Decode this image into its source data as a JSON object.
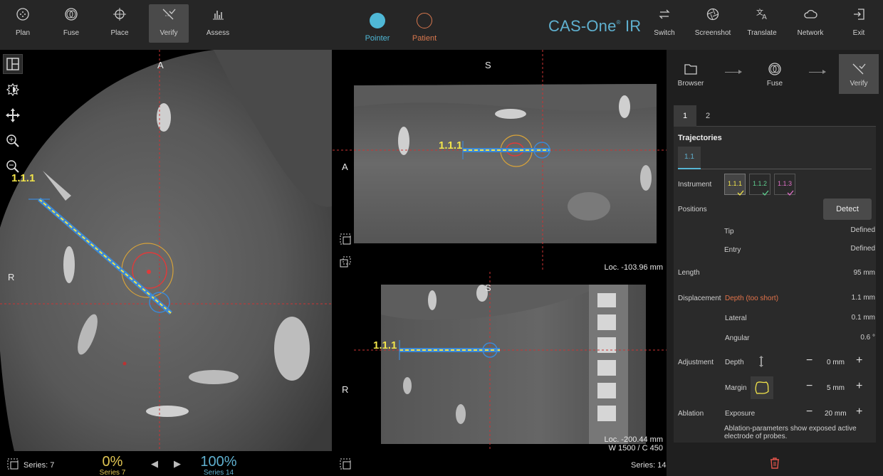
{
  "toolbar": {
    "plan": "Plan",
    "fuse": "Fuse",
    "place": "Place",
    "verify": "Verify",
    "assess": "Assess",
    "pointer": "Pointer",
    "patient": "Patient",
    "brand": "CAS-One",
    "brand_mark": "®",
    "brand_suffix": " IR",
    "switch": "Switch",
    "screenshot": "Screenshot",
    "translate": "Translate",
    "network": "Network",
    "exit": "Exit"
  },
  "colors": {
    "pointer": "#4fb8d6",
    "patient": "#d9784e",
    "brand": "#5fb0cf",
    "trajectory": "#f2e44a",
    "accent": "#58b7d6",
    "warning": "#e2734a"
  },
  "views": {
    "axial": {
      "top": "A",
      "left": "R",
      "traj": "1.1.1"
    },
    "coronal": {
      "top": "S",
      "left": "A",
      "traj": "1.1.1",
      "loc": "Loc. -103.96 mm"
    },
    "sagittal": {
      "top": "S",
      "left": "R",
      "traj": "1.1.1",
      "loc": "Loc. -200.44 mm",
      "wl": "W 1500 / C 450"
    }
  },
  "bottom": {
    "series_left": "Series: 7",
    "pct_left": "0%",
    "pct_left_sub": "Series 7",
    "pct_right": "100%",
    "pct_right_sub": "Series 14",
    "series_right": "Series: 14"
  },
  "panel": {
    "workflow": [
      "Browser",
      "Fuse",
      "Verify"
    ],
    "tabs": [
      "1",
      "2"
    ],
    "section": "Trajectories",
    "subtab": "1.1",
    "instrument_label": "Instrument",
    "instruments": [
      "1.1.1",
      "1.1.2",
      "1.1.3"
    ],
    "positions_label": "Positions",
    "detect": "Detect",
    "tip_label": "Tip",
    "tip_val": "Defined",
    "entry_label": "Entry",
    "entry_val": "Defined",
    "length_label": "Length",
    "length_val": "95 mm",
    "displacement_label": "Displacement",
    "depth_warn": "Depth (too short)",
    "depth_val": "1.1 mm",
    "lateral_label": "Lateral",
    "lateral_val": "0.1 mm",
    "angular_label": "Angular",
    "angular_val": "0.6 °",
    "adjustment_label": "Adjustment",
    "adj_depth_label": "Depth",
    "adj_depth_val": "0 mm",
    "adj_margin_label": "Margin",
    "adj_margin_val": "5 mm",
    "ablation_label": "Ablation",
    "exposure_label": "Exposure",
    "exposure_val": "20 mm",
    "note": "Ablation-parameters show exposed active electrode of probes.",
    "minus": "−",
    "plus": "+"
  }
}
